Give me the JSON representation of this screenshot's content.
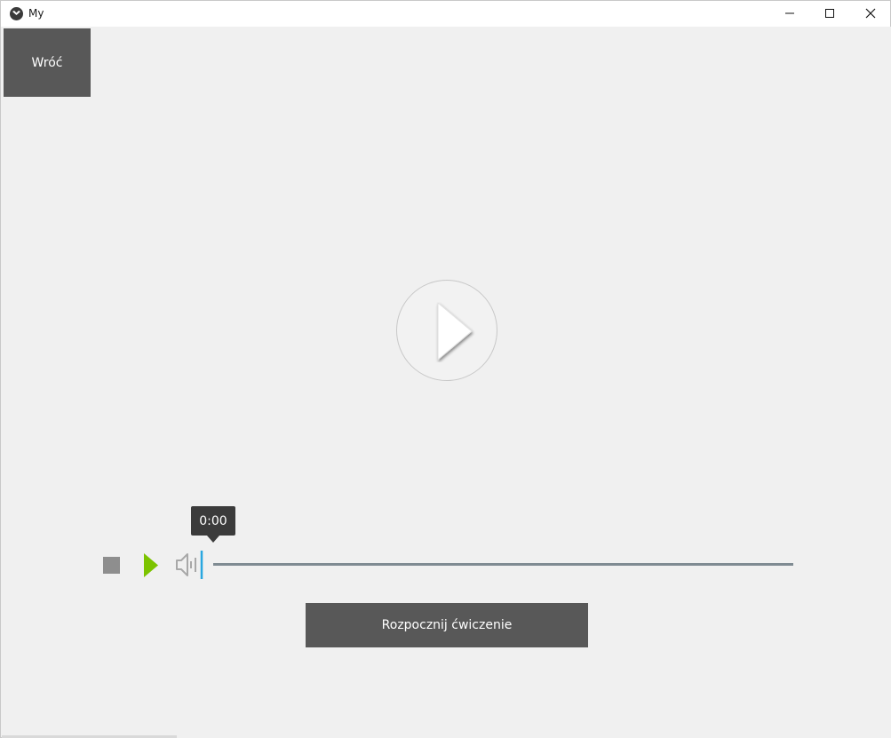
{
  "window": {
    "title": "My",
    "controls": [
      "minimize-icon",
      "maximize-icon",
      "close-icon"
    ]
  },
  "back_button": {
    "label": "Wróć"
  },
  "video": {
    "big_play_icon": "play-circle-icon"
  },
  "player": {
    "stop_icon": "stop-icon",
    "play_icon": "play-icon",
    "volume_icon": "volume-icon",
    "position_label": "0:00",
    "progress": 0,
    "volume_level": 1.0
  },
  "actions": {
    "start_label": "Rozpocznij ćwiczenie"
  },
  "colors": {
    "button_bg": "#585858",
    "play_green": "#7cc300",
    "volume_blue": "#2aa7e0",
    "seek_track": "#7f8b92"
  }
}
